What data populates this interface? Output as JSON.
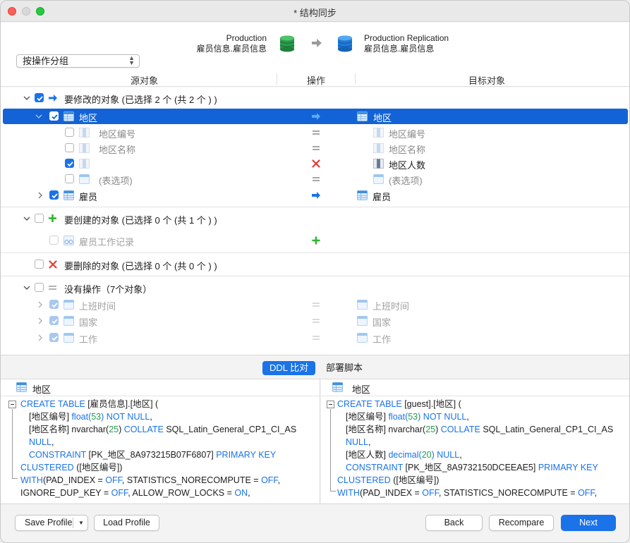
{
  "window": {
    "title": "* 结构同步"
  },
  "header": {
    "source": {
      "server": "Production",
      "schema": "雇员信息.雇员信息"
    },
    "target": {
      "server": "Production Replication",
      "schema": "雇员信息.雇员信息"
    },
    "group_select": {
      "value": "按操作分组"
    }
  },
  "columns": {
    "source": "源对象",
    "operation": "操作",
    "target": "目标对象"
  },
  "tree": {
    "modify_group": {
      "label": "要修改的对象 (已选择 2 个 (共 2 个 ) )"
    },
    "table_region": {
      "source": "地区",
      "target": "地区"
    },
    "fields": [
      {
        "source": "地区编号",
        "target": "地区编号",
        "op": "equal"
      },
      {
        "source": "地区名称",
        "target": "地区名称",
        "op": "equal"
      },
      {
        "source": "",
        "target": "地区人数",
        "op": "delete"
      },
      {
        "source": "(表选项)",
        "target": "(表选项)",
        "op": "equal"
      }
    ],
    "table_employee": {
      "source": "雇员",
      "target": "雇员"
    },
    "create_group": {
      "label": "要创建的对象 (已选择 0 个 (共 1 个 ) )"
    },
    "create_item": {
      "source": "雇员工作记录"
    },
    "delete_group": {
      "label": "要删除的对象 (已选择 0 个 (共 0 个 ) )"
    },
    "noop_group": {
      "label": "没有操作（7个对象）"
    },
    "noop_items": [
      {
        "source": "上班时间",
        "target": "上班时间"
      },
      {
        "source": "国家",
        "target": "国家"
      },
      {
        "source": "工作",
        "target": "工作"
      }
    ]
  },
  "tabs": {
    "ddl": "DDL 比对",
    "deploy": "部署脚本"
  },
  "ddl": {
    "left": {
      "title": "地区",
      "lines": {
        "l1a": "CREATE TABLE",
        "l1b": "[雇员信息].[地区] (",
        "l2a": "[地区编号]",
        "l2b": "float(",
        "l2c": "53",
        "l2d": ")",
        "l2e": "NOT NULL",
        "l2f": ",",
        "l3a": "[地区名称] nvarchar(",
        "l3b": "25",
        "l3c": ")",
        "l3d": "COLLATE",
        "l3e": "SQL_Latin_General_CP1_CI_AS",
        "l4a": "NULL",
        "l4b": ",",
        "l5a": "CONSTRAINT",
        "l5b": "[PK_地区_8A973215B07F6807]",
        "l5c": "PRIMARY KEY",
        "l6a": "CLUSTERED",
        "l6b": "([地区编号])",
        "l7a": "WITH",
        "l7b": "(PAD_INDEX =",
        "l7c": "OFF",
        "l7d": ", STATISTICS_NORECOMPUTE =",
        "l7e": "OFF",
        "l7f": ",",
        "l8a": "IGNORE_DUP_KEY =",
        "l8b": "OFF",
        "l8c": ", ALLOW_ROW_LOCKS =",
        "l8d": "ON",
        "l8e": ","
      }
    },
    "right": {
      "title": "地区",
      "lines": {
        "l1a": "CREATE TABLE",
        "l1b": "[guest].[地区] (",
        "l2a": "[地区编号]",
        "l2b": "float(",
        "l2c": "53",
        "l2d": ")",
        "l2e": "NOT NULL",
        "l2f": ",",
        "l3a": "[地区名称] nvarchar(",
        "l3b": "25",
        "l3c": ")",
        "l3d": "COLLATE",
        "l3e": "SQL_Latin_General_CP1_CI_AS",
        "l4a": "NULL",
        "l4b": ",",
        "l5a": "[地区人数]",
        "l5b": "decimal(",
        "l5c": "20",
        "l5d": ")",
        "l5e": "NULL",
        "l5f": ",",
        "l6a": "CONSTRAINT",
        "l6b": "[PK_地区_8A9732150DCEEAE5]",
        "l6c": "PRIMARY KEY",
        "l7a": "CLUSTERED",
        "l7b": "([地区编号])",
        "l8a": "WITH",
        "l8b": "(PAD_INDEX =",
        "l8c": "OFF",
        "l8d": ", STATISTICS_NORECOMPUTE =",
        "l8e": "OFF",
        "l8f": ","
      }
    }
  },
  "footer": {
    "save_profile": "Save Profile",
    "load_profile": "Load Profile",
    "back": "Back",
    "recompare": "Recompare",
    "next": "Next"
  },
  "colors": {
    "accent": "#1a73e8",
    "selection": "#1463d6",
    "add": "#2db52d",
    "delete": "#e53935"
  }
}
